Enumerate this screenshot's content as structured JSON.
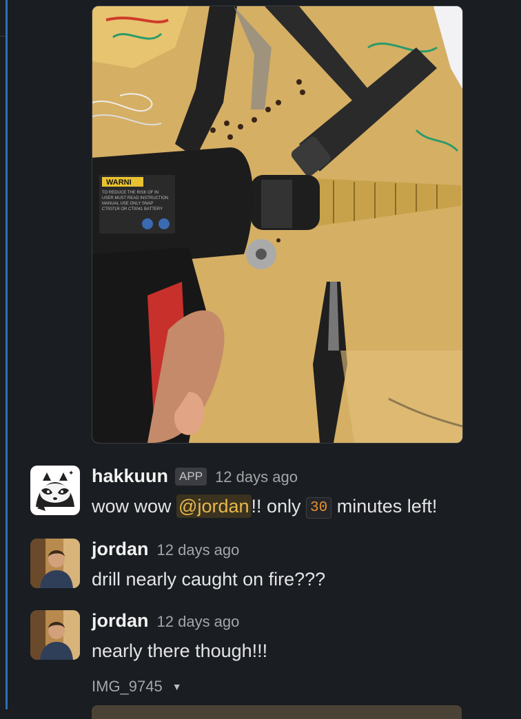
{
  "attachment_top": {
    "kind": "image"
  },
  "messages": [
    {
      "author": "hakkuun",
      "badge": "APP",
      "time": "12 days ago",
      "parts": {
        "before": "wow wow ",
        "mention": "@jordan",
        "middle": "!! only ",
        "code": "30",
        "after": " minutes left!"
      }
    },
    {
      "author": "jordan",
      "time": "12 days ago",
      "text": "drill nearly caught on fire???"
    },
    {
      "author": "jordan",
      "time": "12 days ago",
      "text": "nearly there though!!!",
      "file": {
        "name": "IMG_9745",
        "collapse_icon": "caret-down-icon"
      }
    }
  ],
  "colors": {
    "background": "#1a1d21",
    "rail": "#2f6fb8",
    "mention_bg": "#3b3320",
    "mention_fg": "#e8b84c",
    "code_fg": "#e8912d"
  }
}
